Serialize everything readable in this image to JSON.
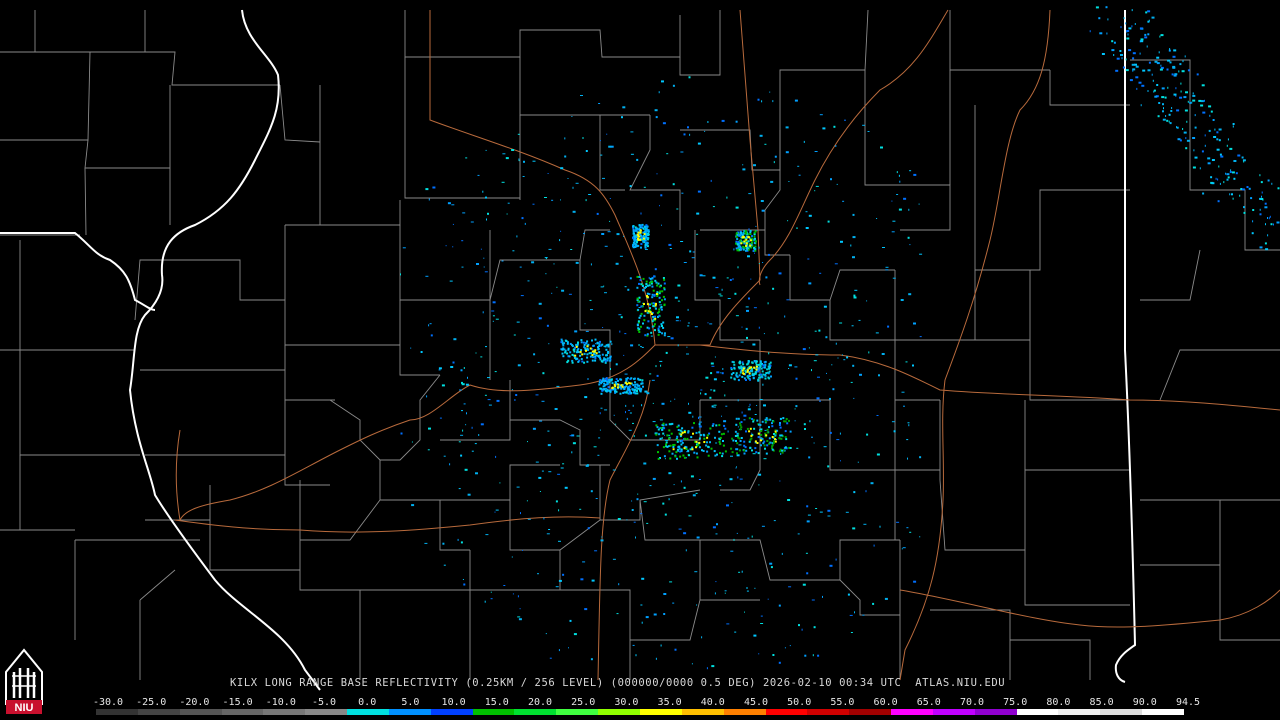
{
  "map": {
    "radar_site": "KILX",
    "caption": "KILX LONG RANGE BASE REFLECTIVITY (0.25KM / 256 LEVEL) (000000/0000 0.5 DEG) 2026-02-10 00:34 UTC  ATLAS.NIU.EDU",
    "logo_text": "NIU",
    "colors": {
      "background": "#000000",
      "county_lines": "#8a8a8a",
      "state_lines": "#ffffff",
      "highways": "#b86a3c",
      "text": "#d8d8d8"
    }
  },
  "legend": {
    "ticks": [
      "-30.0",
      "-25.0",
      "-20.0",
      "-15.0",
      "-10.0",
      "-5.0",
      "0.0",
      "5.0",
      "10.0",
      "15.0",
      "20.0",
      "25.0",
      "30.0",
      "35.0",
      "40.0",
      "45.0",
      "50.0",
      "55.0",
      "60.0",
      "65.0",
      "70.0",
      "75.0",
      "80.0",
      "85.0",
      "90.0",
      "94.5"
    ],
    "colors": [
      "#333333",
      "#444444",
      "#555555",
      "#666666",
      "#777777",
      "#888888",
      "#00e0e0",
      "#0090ff",
      "#0040ff",
      "#00c000",
      "#00e030",
      "#40ff40",
      "#90ff00",
      "#ffff00",
      "#ffc000",
      "#ff8000",
      "#ff0000",
      "#d00000",
      "#a00000",
      "#ff00ff",
      "#c000ff",
      "#9000d0",
      "#ffffff",
      "#eeeeee",
      "#dddddd",
      "#ffffff"
    ]
  }
}
